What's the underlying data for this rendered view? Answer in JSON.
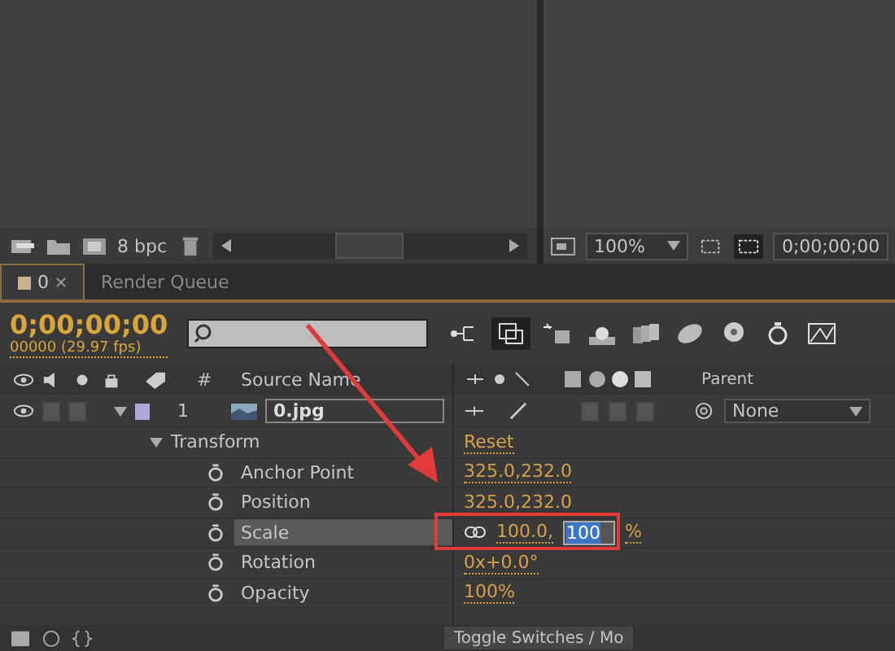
{
  "project_panel": {
    "bit_depth": "8 bpc"
  },
  "viewer": {
    "zoom": "100%",
    "timecode": "0;00;00;00"
  },
  "tabs": [
    {
      "label": "0",
      "selected": true
    },
    {
      "label": "Render Queue",
      "selected": false
    }
  ],
  "timeline": {
    "timecode": "0;00;00;00",
    "frame_info": "00000 (29.97 fps)",
    "columns": {
      "number": "#",
      "source": "Source Name",
      "parent": "Parent"
    },
    "layer": {
      "number": "1",
      "name": "0.jpg",
      "parent": "None",
      "expanded": true
    },
    "transform": {
      "label": "Transform",
      "reset": "Reset",
      "expanded": true
    },
    "properties": [
      {
        "kind": "value",
        "name": "Anchor Point",
        "value": "325.0,232.0",
        "selected": false
      },
      {
        "kind": "value",
        "name": "Position",
        "value": "325.0,232.0",
        "selected": false
      },
      {
        "kind": "scale",
        "name": "Scale",
        "value": "100.0,",
        "edit_value": "100",
        "unit": "%",
        "selected": true
      },
      {
        "kind": "value",
        "name": "Rotation",
        "value": "0x+0.0°",
        "selected": false
      },
      {
        "kind": "value",
        "name": "Opacity",
        "value": "100%",
        "selected": false
      }
    ]
  },
  "bottom_bar": {
    "toggle": "Toggle Switches / Mo"
  }
}
